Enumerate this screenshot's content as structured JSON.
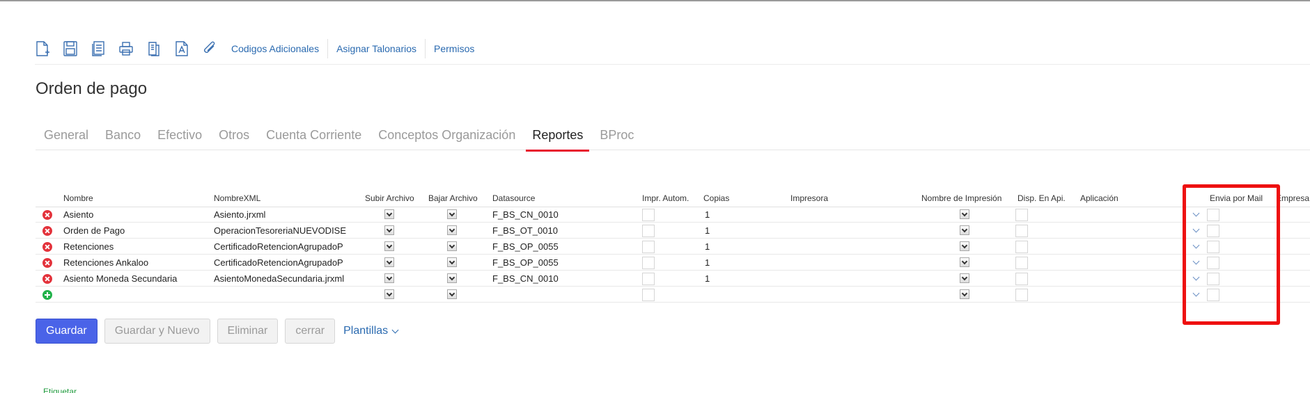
{
  "toolbar": {
    "icons": [
      "new-document-icon",
      "save-icon",
      "copy-icon",
      "print-icon",
      "report-icon",
      "text-document-icon",
      "attachment-icon"
    ],
    "links": [
      "Codigos Adicionales",
      "Asignar Talonarios",
      "Permisos"
    ]
  },
  "page": {
    "title": "Orden de pago"
  },
  "tabs": [
    "General",
    "Banco",
    "Efectivo",
    "Otros",
    "Cuenta Corriente",
    "Conceptos Organización",
    "Reportes",
    "BProc"
  ],
  "active_tab": "Reportes",
  "table": {
    "headers": {
      "nombre": "Nombre",
      "nombre_xml": "NombreXML",
      "subir_archivo": "Subir Archivo",
      "bajar_archivo": "Bajar Archivo",
      "datasource": "Datasource",
      "impr_autom": "Impr. Autom.",
      "copias": "Copias",
      "impresora": "Impresora",
      "nombre_impresion": "Nombre de Impresión",
      "disp_en_api": "Disp. En Api.",
      "aplicacion": "Aplicación",
      "envia_por_mail": "Envia por Mail",
      "empresa": "Empresa"
    },
    "rows": [
      {
        "nombre": "Asiento",
        "nombre_xml": "Asiento.jrxml",
        "datasource": "F_BS_CN_0010",
        "copias": "1"
      },
      {
        "nombre": "Orden de Pago",
        "nombre_xml": "OperacionTesoreriaNUEVODISE",
        "datasource": "F_BS_OT_0010",
        "copias": "1"
      },
      {
        "nombre": "Retenciones",
        "nombre_xml": "CertificadoRetencionAgrupadoP",
        "datasource": "F_BS_OP_0055",
        "copias": "1"
      },
      {
        "nombre": "Retenciones Ankaloo",
        "nombre_xml": "CertificadoRetencionAgrupadoP",
        "datasource": "F_BS_OP_0055",
        "copias": "1"
      },
      {
        "nombre": "Asiento Moneda Secundaria",
        "nombre_xml": "AsientoMonedaSecundaria.jrxml",
        "datasource": "F_BS_CN_0010",
        "copias": "1"
      },
      {
        "nombre": "",
        "nombre_xml": "",
        "datasource": "",
        "copias": ""
      }
    ]
  },
  "buttons": {
    "guardar": "Guardar",
    "guardar_nuevo": "Guardar y Nuevo",
    "eliminar": "Eliminar",
    "cerrar": "cerrar",
    "plantillas": "Plantillas"
  },
  "footer": {
    "etiquetar": "Etiquetar"
  },
  "colors": {
    "primary": "#4a63e8",
    "link": "#2a6ab0",
    "tab_underline": "#e8142d",
    "highlight": "#ee1010",
    "delete": "#e3323b",
    "add": "#21b24a"
  }
}
